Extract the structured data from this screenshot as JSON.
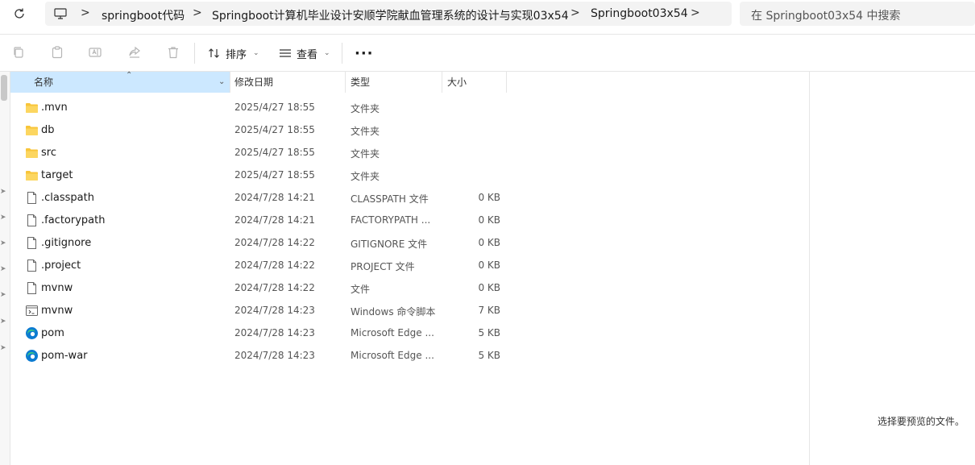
{
  "address_bar": {
    "breadcrumbs": [
      "springboot代码",
      "Springboot计算机毕业设计安顺学院献血管理系统的设计与实现03x54",
      "Springboot03x54"
    ],
    "separator": ">"
  },
  "search": {
    "placeholder": "在 Springboot03x54 中搜索"
  },
  "toolbar": {
    "sort_label": "排序",
    "view_label": "查看",
    "more_label": "···"
  },
  "columns": {
    "name": "名称",
    "modified": "修改日期",
    "type": "类型",
    "size": "大小"
  },
  "files": [
    {
      "name": ".mvn",
      "modified": "2025/4/27 18:55",
      "type": "文件夹",
      "size": "",
      "icon": "folder-icon"
    },
    {
      "name": "db",
      "modified": "2025/4/27 18:55",
      "type": "文件夹",
      "size": "",
      "icon": "folder-icon"
    },
    {
      "name": "src",
      "modified": "2025/4/27 18:55",
      "type": "文件夹",
      "size": "",
      "icon": "folder-icon"
    },
    {
      "name": "target",
      "modified": "2025/4/27 18:55",
      "type": "文件夹",
      "size": "",
      "icon": "folder-icon"
    },
    {
      "name": ".classpath",
      "modified": "2024/7/28 14:21",
      "type": "CLASSPATH 文件",
      "size": "0 KB",
      "icon": "file-icon"
    },
    {
      "name": ".factorypath",
      "modified": "2024/7/28 14:21",
      "type": "FACTORYPATH ...",
      "size": "0 KB",
      "icon": "file-icon"
    },
    {
      "name": ".gitignore",
      "modified": "2024/7/28 14:22",
      "type": "GITIGNORE 文件",
      "size": "0 KB",
      "icon": "file-icon"
    },
    {
      "name": ".project",
      "modified": "2024/7/28 14:22",
      "type": "PROJECT 文件",
      "size": "0 KB",
      "icon": "file-icon"
    },
    {
      "name": "mvnw",
      "modified": "2024/7/28 14:22",
      "type": "文件",
      "size": "0 KB",
      "icon": "file-icon"
    },
    {
      "name": "mvnw",
      "modified": "2024/7/28 14:23",
      "type": "Windows 命令脚本",
      "size": "7 KB",
      "icon": "script-icon"
    },
    {
      "name": "pom",
      "modified": "2024/7/28 14:23",
      "type": "Microsoft Edge ...",
      "size": "5 KB",
      "icon": "edge-icon"
    },
    {
      "name": "pom-war",
      "modified": "2024/7/28 14:23",
      "type": "Microsoft Edge ...",
      "size": "5 KB",
      "icon": "edge-icon"
    }
  ],
  "preview_pane": {
    "message": "选择要预览的文件。"
  },
  "colors": {
    "header_selected": "#cce8ff",
    "folder": "#f8c53a",
    "edge": "#0c7bd1"
  }
}
